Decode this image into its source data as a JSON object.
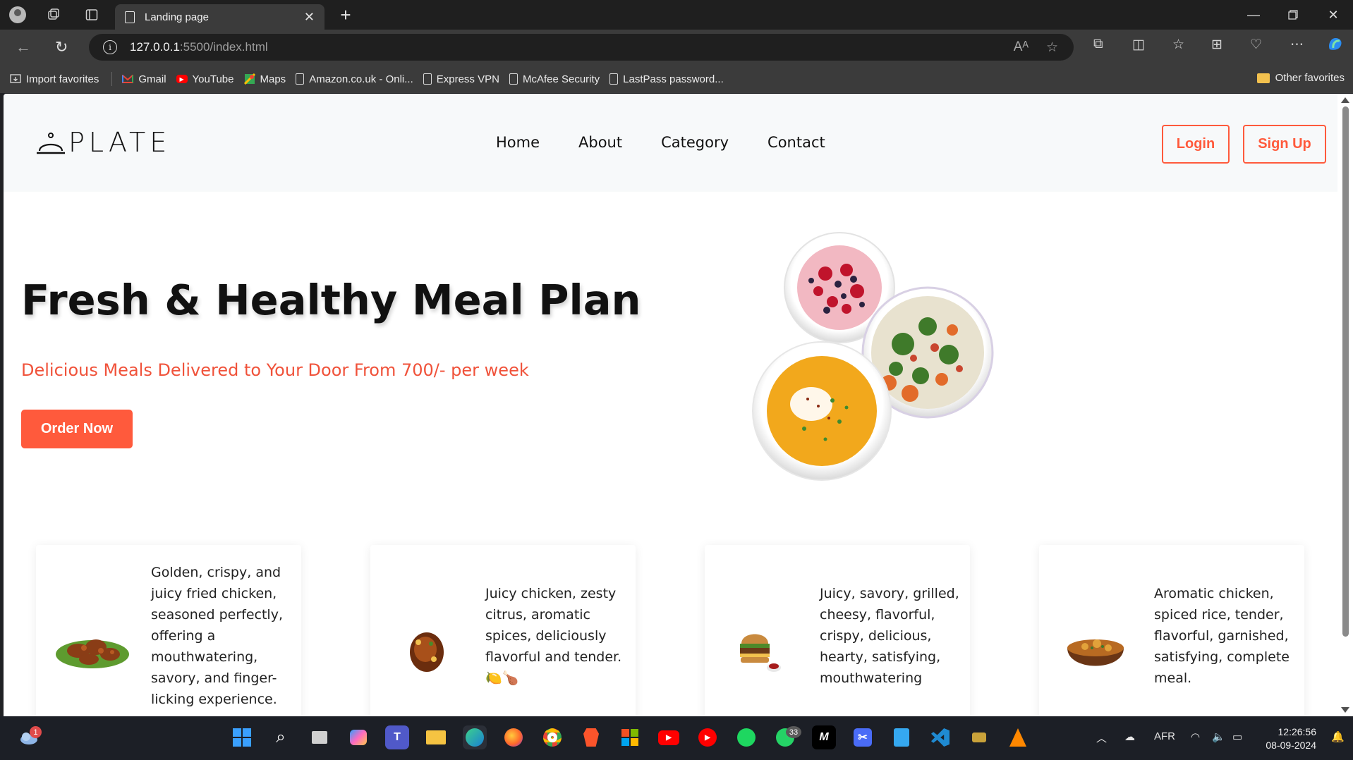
{
  "browser": {
    "tab_title": "Landing page",
    "url_host": "127.0.0.1",
    "url_path": ":5500/index.html",
    "bookmarks": [
      {
        "label": "Import favorites",
        "icon": "import-icon"
      },
      {
        "label": "Gmail",
        "icon": "gmail-icon"
      },
      {
        "label": "YouTube",
        "icon": "youtube-icon"
      },
      {
        "label": "Maps",
        "icon": "maps-icon"
      },
      {
        "label": "Amazon.co.uk - Onli...",
        "icon": "file-icon"
      },
      {
        "label": "Express VPN",
        "icon": "file-icon"
      },
      {
        "label": "McAfee Security",
        "icon": "file-icon"
      },
      {
        "label": "LastPass password...",
        "icon": "file-icon"
      }
    ],
    "other_favorites": "Other favorites"
  },
  "site": {
    "logo_text": "PLATE",
    "nav": [
      "Home",
      "About",
      "Category",
      "Contact"
    ],
    "login": "Login",
    "signup": "Sign Up",
    "hero_title": "Fresh & Healthy Meal Plan",
    "hero_subtitle": "Delicious Meals Delivered to Your Door From 700/- per week",
    "order_button": "Order Now",
    "cards": [
      {
        "text": "Golden, crispy, and juicy fried chicken, seasoned perfectly, offering a mouthwatering, savory, and finger-licking experience.",
        "image": "fried-chicken"
      },
      {
        "text": "Juicy chicken, zesty citrus, aromatic spices, deliciously flavorful and tender. 🍋🍗",
        "image": "roast-chicken"
      },
      {
        "text": "Juicy, savory, grilled, cheesy, flavorful, crispy, delicious, hearty, satisfying, mouthwatering",
        "image": "burger"
      },
      {
        "text": "Aromatic chicken, spiced rice, tender, flavorful, garnished, satisfying, complete meal.",
        "image": "biryani"
      }
    ]
  },
  "taskbar": {
    "weather_badge": "1",
    "whatsapp_badge": "33",
    "language": "AFR",
    "time": "12:26:56",
    "date": "08-09-2024"
  },
  "colors": {
    "accent": "#ff5a3c",
    "header_bg": "#f7f9fa"
  }
}
